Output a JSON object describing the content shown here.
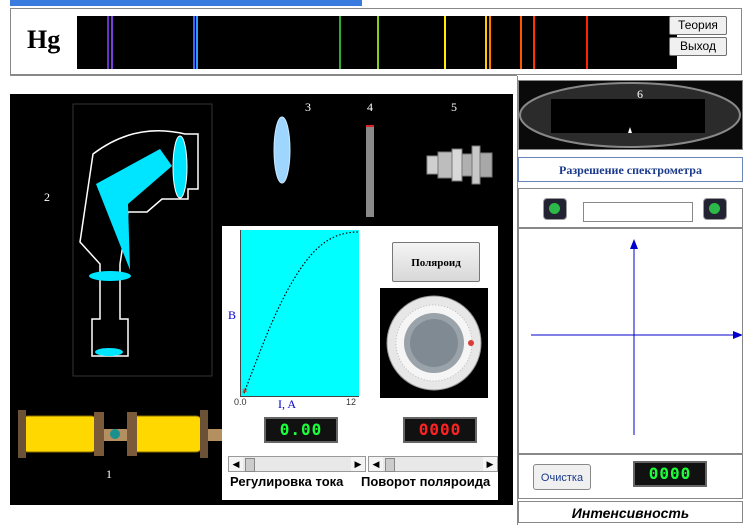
{
  "header": {
    "element": "Hg",
    "theory_label": "Теория",
    "exit_label": "Выход"
  },
  "spectrum_lines": [
    {
      "color": "#6633cc"
    },
    {
      "color": "#7a3fd9"
    },
    {
      "color": "#3a66ff"
    },
    {
      "color": "#3399ff"
    },
    {
      "color": "#33aa33"
    },
    {
      "color": "#88cc22"
    },
    {
      "color": "#ffee00"
    },
    {
      "color": "#ffcc00"
    },
    {
      "color": "#ff7a00"
    },
    {
      "color": "#ff5500"
    },
    {
      "color": "#ff3300"
    },
    {
      "color": "#ff2200"
    }
  ],
  "stage": {
    "label_1": "1",
    "label_2": "2",
    "label_3": "3",
    "label_4": "4",
    "label_5": "5"
  },
  "plot": {
    "y_label": "B",
    "x_label": "I, A",
    "x_min": "0.0",
    "x_max": "12"
  },
  "polaroid_button": "Поляроид",
  "current_display": "0.00",
  "angle_display": "0000",
  "current_slider_label": "Регулировка тока",
  "polarizer_slider_label": "Поворот поляроида",
  "right_panel": {
    "eyepiece_label": "6",
    "resolution_button": "Разрешение спектрометра",
    "resolution_value": "",
    "clear_button": "Очистка",
    "intensity_display": "0000",
    "intensity_label": "Интенсивность"
  },
  "colors": {
    "accent": "#3a7be0",
    "plot_bg": "#00ffff",
    "axis_blue": "#0000cc",
    "prism": "#00e5ff",
    "magnet": "#ffd800"
  }
}
